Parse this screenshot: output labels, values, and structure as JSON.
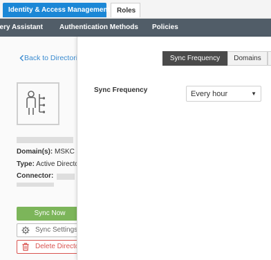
{
  "top_tabs": [
    {
      "label": "Identity & Access Management",
      "active": true
    },
    {
      "label": "Roles",
      "active": false
    }
  ],
  "nav": [
    {
      "label": "very Assistant"
    },
    {
      "label": "Authentication Methods"
    },
    {
      "label": "Policies"
    }
  ],
  "left_panel": {
    "back_link": "Back to Directories",
    "domain_label": "Domain(s):",
    "domain_value": "MSKC",
    "type_label": "Type:",
    "type_value": "Active Directory",
    "connector_label": "Connector:",
    "sync_now": "Sync Now",
    "sync_settings": "Sync Settings",
    "delete": "Delete Directory",
    "icons": {
      "back": "chevron-left-icon",
      "directory": "directory-user-icon",
      "settings": "gear-icon",
      "delete": "trash-icon"
    }
  },
  "sync_panel": {
    "segments": [
      "Sync Frequency",
      "Domains"
    ],
    "active_segment": "Sync Frequency",
    "field_label": "Sync Frequency",
    "field_value": "Every hour"
  },
  "colors": {
    "primary_tab": "#1b87d6",
    "nav": "#515d68",
    "sync_now": "#7cb55a",
    "danger": "#d9534f",
    "segment_active": "#4a4a4a",
    "link": "#3a8bd0"
  }
}
